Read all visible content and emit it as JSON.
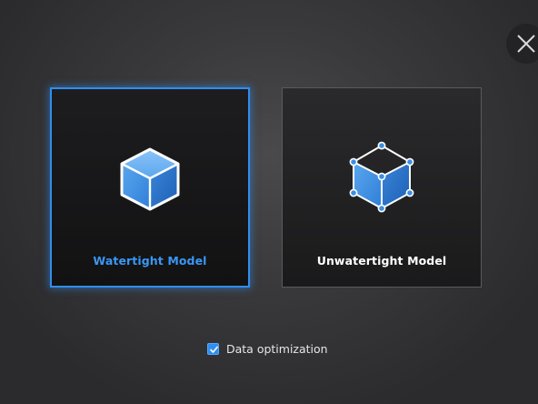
{
  "dialog": {
    "close_icon": "close-icon",
    "cards": [
      {
        "label": "Watertight Model",
        "icon": "solid-cube-icon",
        "selected": true
      },
      {
        "label": "Unwatertight Model",
        "icon": "wireframe-cube-icon",
        "selected": false
      }
    ],
    "option": {
      "label": "Data optimization",
      "checked": true
    }
  },
  "colors": {
    "accent": "#2f8ef0",
    "background": "#3a3a3c",
    "card_bg": "#161617",
    "text_primary": "#ffffff"
  }
}
